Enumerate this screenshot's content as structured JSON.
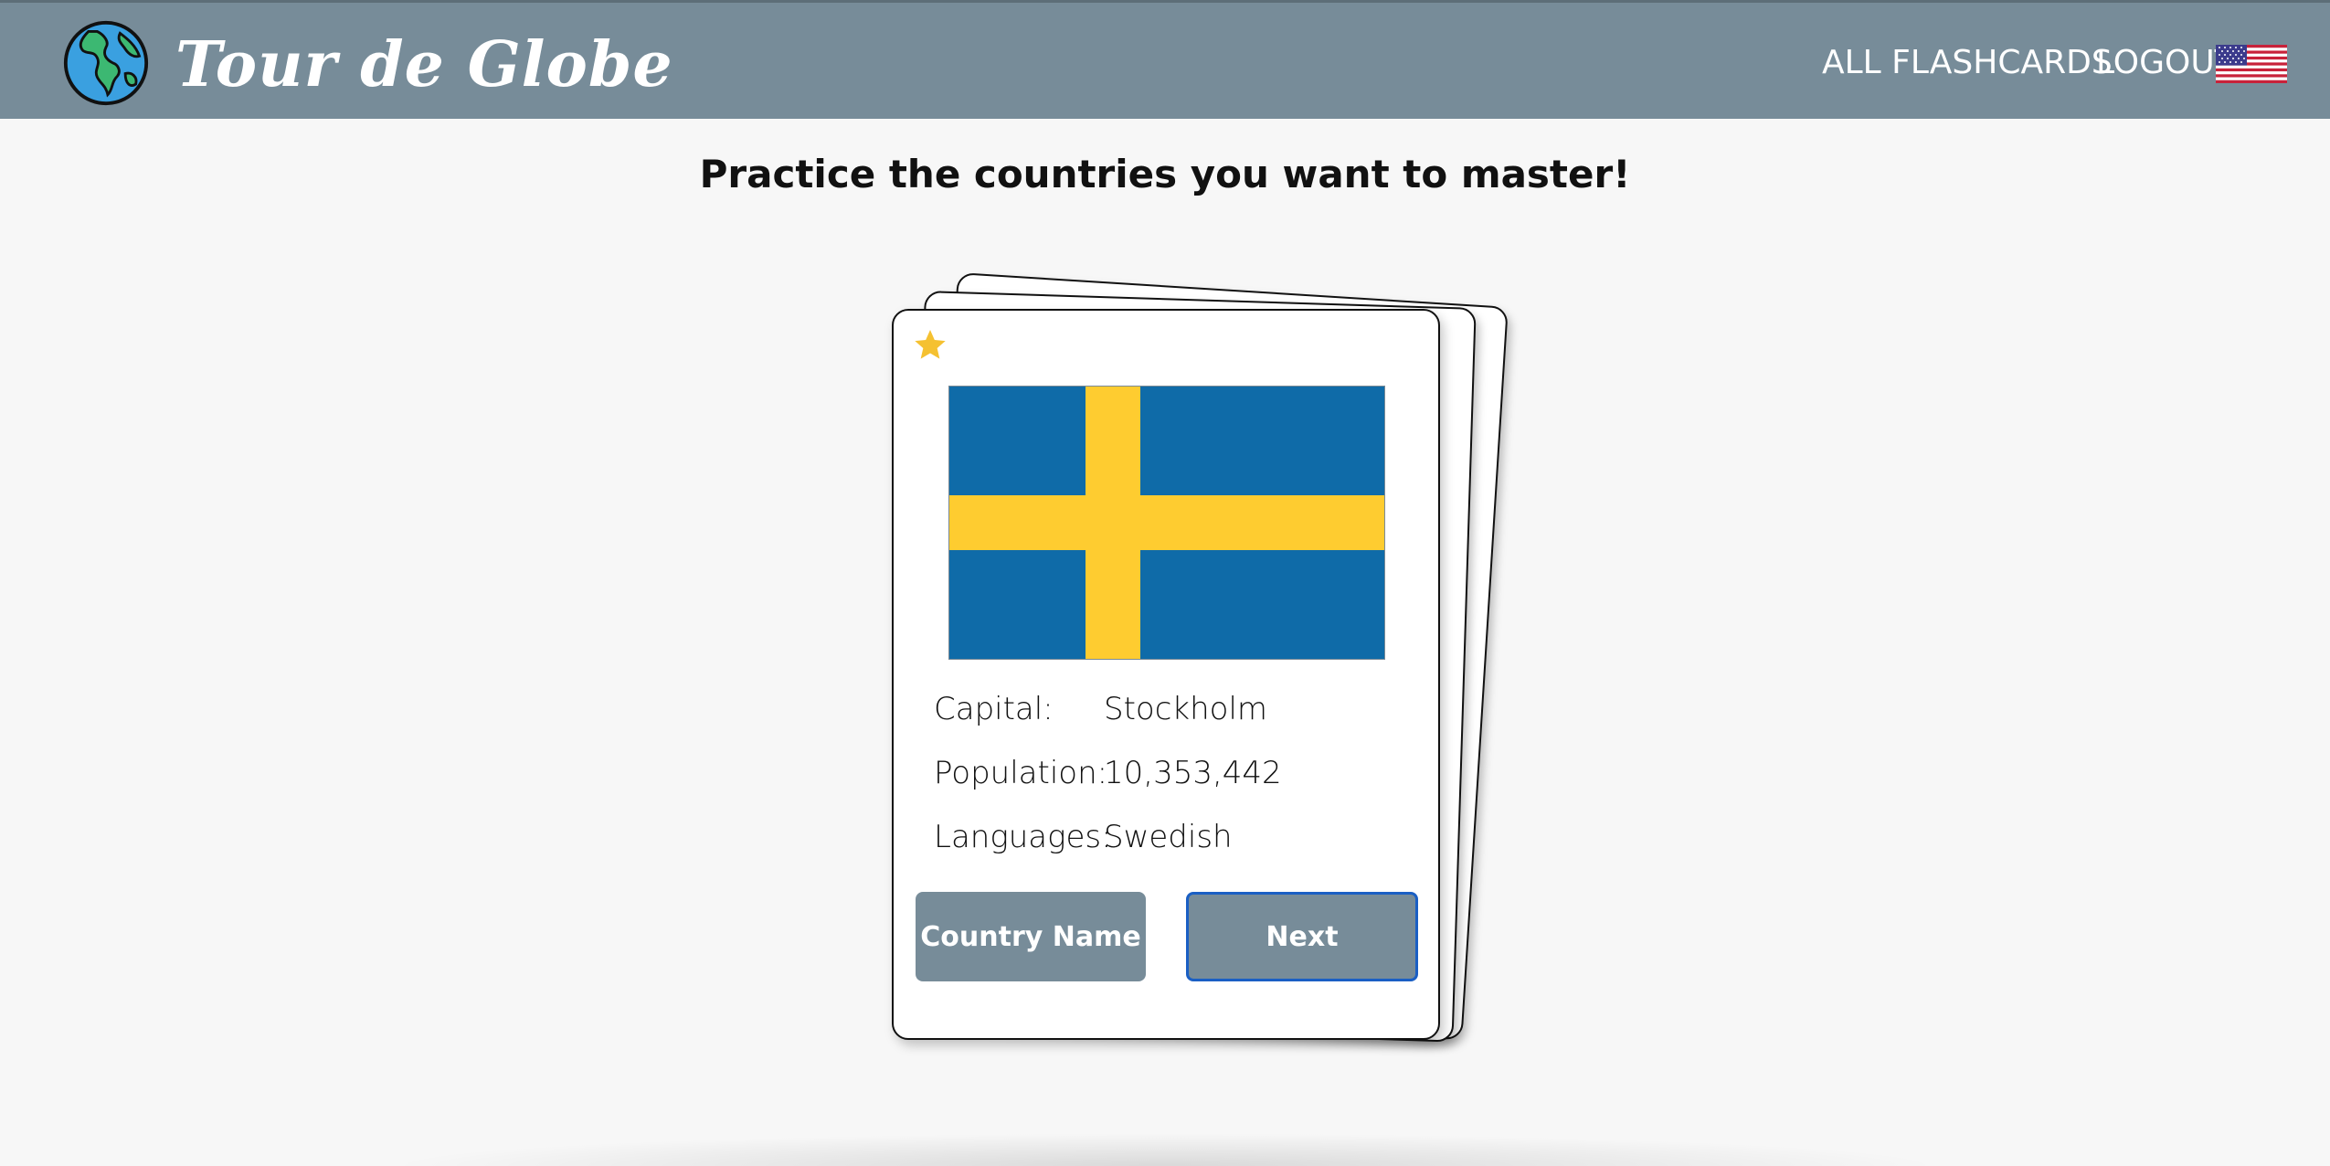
{
  "header": {
    "brand": "Tour de Globe",
    "logo_icon": "globe-icon",
    "nav": {
      "all_flashcards": "ALL FLASHCARDS",
      "logout": "LOGOUT"
    },
    "language_flag_icon": "us-flag-icon"
  },
  "page": {
    "title": "Practice the countries you want to master!"
  },
  "card": {
    "favorite_icon": "star-icon",
    "favorite_color": "#f5c131",
    "flag_icon": "sweden-flag",
    "flag_colors": {
      "blue": "#0f6ba8",
      "yellow": "#fecc30"
    },
    "fields": [
      {
        "label": "Capital:",
        "value": "Stockholm"
      },
      {
        "label": "Population:",
        "value": "10,353,442"
      },
      {
        "label": "Languages:",
        "value": "Swedish"
      }
    ],
    "buttons": {
      "country_name": "Country Name",
      "next": "Next"
    }
  },
  "colors": {
    "header_bg": "#778c99",
    "button_bg": "#778c99",
    "focus_ring": "#1a5fc4",
    "page_bg": "#f7f7f7"
  }
}
